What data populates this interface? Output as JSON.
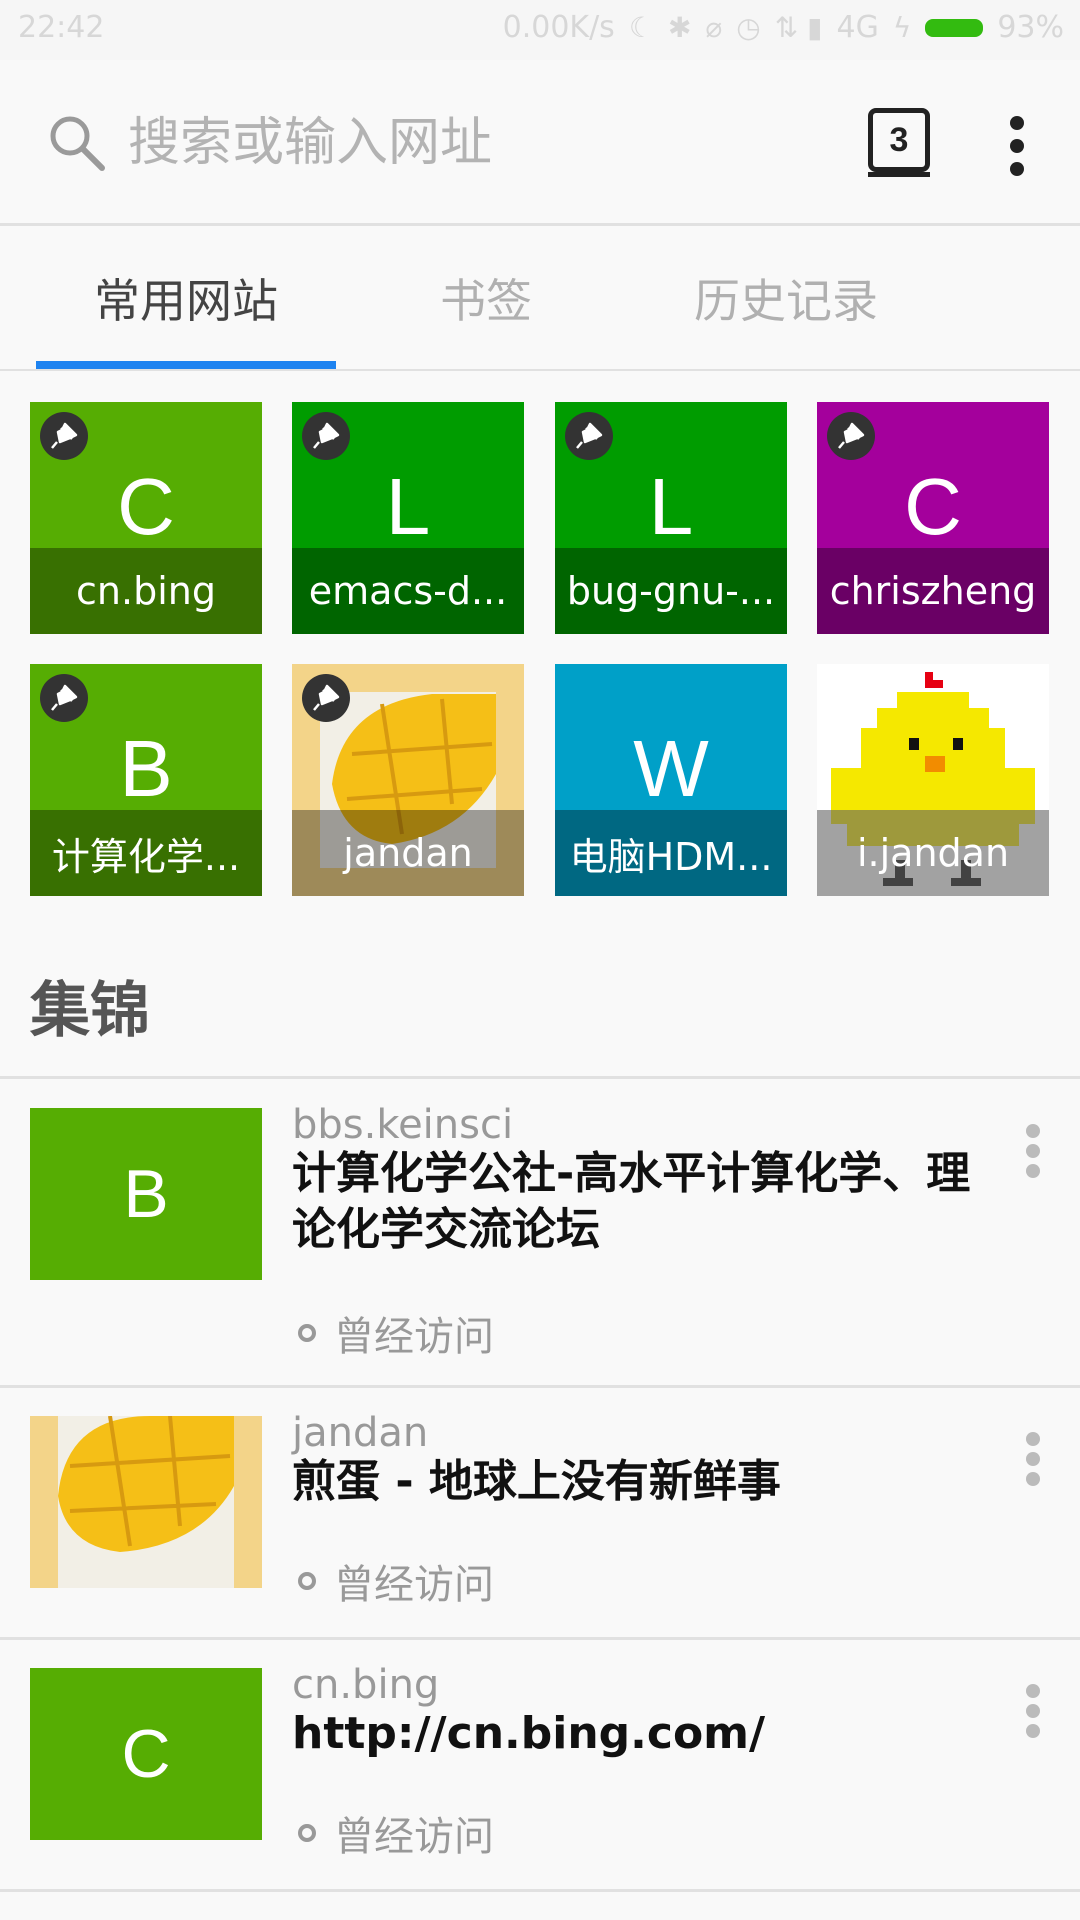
{
  "status_bar": {
    "time": "22:42",
    "net_speed": "0.00K/s",
    "network": "4G",
    "battery": "93%"
  },
  "search": {
    "placeholder": "搜索或输入网址"
  },
  "tab_count": "3",
  "tabs": [
    {
      "label": "常用网站",
      "active": true
    },
    {
      "label": "书签",
      "active": false
    },
    {
      "label": "历史记录",
      "active": false
    }
  ],
  "tiles": [
    {
      "letter": "C",
      "label": "cn.bing",
      "color": "#56ad03",
      "pinned": true
    },
    {
      "letter": "L",
      "label": "emacs-d...",
      "color": "#009c00",
      "pinned": true
    },
    {
      "letter": "L",
      "label": "bug-gnu-...",
      "color": "#009c00",
      "pinned": true
    },
    {
      "letter": "C",
      "label": "chriszheng",
      "color": "#a4009c",
      "pinned": true
    },
    {
      "letter": "B",
      "label": "计算化学...",
      "color": "#56ad03",
      "pinned": true
    },
    {
      "letter": "",
      "label": "jandan",
      "color": "#f3d489",
      "pinned": true,
      "icon": "mango-icon"
    },
    {
      "letter": "W",
      "label": "电脑HDM...",
      "color": "#00a0c8",
      "pinned": false
    },
    {
      "letter": "",
      "label": "i.jandan",
      "color": "#ffffff",
      "pinned": false,
      "icon": "chick-icon"
    }
  ],
  "section_title": "集锦",
  "cards": [
    {
      "thumb_letter": "B",
      "thumb_color": "#56ad03",
      "domain": "bbs.keinsci",
      "title": "计算化学公社-高水平计算化学、理论化学交流论坛",
      "status": "曾经访问"
    },
    {
      "thumb_letter": "",
      "thumb_color": "#f3d489",
      "thumb_icon": "mango-icon",
      "domain": "jandan",
      "title": "煎蛋 - 地球上没有新鲜事",
      "status": "曾经访问"
    },
    {
      "thumb_letter": "C",
      "thumb_color": "#56ad03",
      "domain": "cn.bing",
      "title": "http://cn.bing.com/",
      "status": "曾经访问"
    }
  ],
  "colors": {
    "accent": "#1e83f0"
  }
}
